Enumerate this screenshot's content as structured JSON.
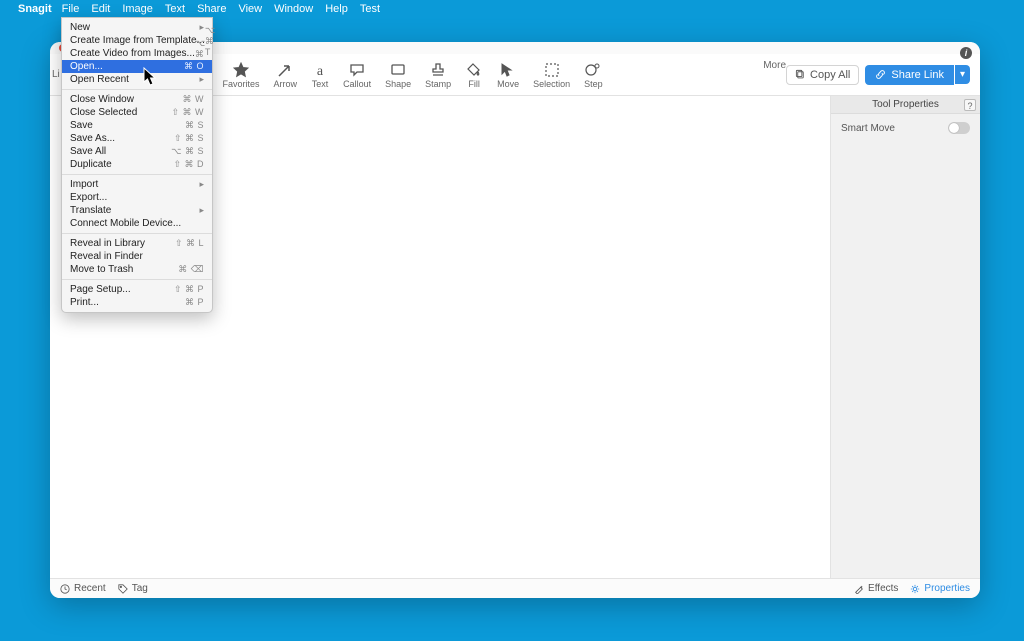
{
  "menubar": {
    "app": "Snagit",
    "items": [
      "File",
      "Edit",
      "Image",
      "Text",
      "Share",
      "View",
      "Window",
      "Help",
      "Test"
    ]
  },
  "file_menu": {
    "groups": [
      [
        {
          "label": "New",
          "shortcut": "",
          "arrow": true,
          "highlight": false
        },
        {
          "label": "Create Image from Template...",
          "shortcut": "⌥ ⌘ T",
          "arrow": false,
          "highlight": false
        },
        {
          "label": "Create Video from Images...",
          "shortcut": "⌥ ⌘ V",
          "arrow": false,
          "highlight": false
        },
        {
          "label": "Open...",
          "shortcut": "⌘ O",
          "arrow": false,
          "highlight": true
        },
        {
          "label": "Open Recent",
          "shortcut": "",
          "arrow": true,
          "highlight": false
        }
      ],
      [
        {
          "label": "Close Window",
          "shortcut": "⌘ W",
          "arrow": false,
          "highlight": false
        },
        {
          "label": "Close Selected",
          "shortcut": "⇧ ⌘ W",
          "arrow": false,
          "highlight": false
        },
        {
          "label": "Save",
          "shortcut": "⌘ S",
          "arrow": false,
          "highlight": false
        },
        {
          "label": "Save As...",
          "shortcut": "⇧ ⌘ S",
          "arrow": false,
          "highlight": false
        },
        {
          "label": "Save All",
          "shortcut": "⌥ ⌘ S",
          "arrow": false,
          "highlight": false
        },
        {
          "label": "Duplicate",
          "shortcut": "⇧ ⌘ D",
          "arrow": false,
          "highlight": false
        }
      ],
      [
        {
          "label": "Import",
          "shortcut": "",
          "arrow": true,
          "highlight": false
        },
        {
          "label": "Export...",
          "shortcut": "",
          "arrow": false,
          "highlight": false
        },
        {
          "label": "Translate",
          "shortcut": "",
          "arrow": true,
          "highlight": false
        },
        {
          "label": "Connect Mobile Device...",
          "shortcut": "",
          "arrow": false,
          "highlight": false
        }
      ],
      [
        {
          "label": "Reveal in Library",
          "shortcut": "⇧ ⌘ L",
          "arrow": false,
          "highlight": false
        },
        {
          "label": "Reveal in Finder",
          "shortcut": "",
          "arrow": false,
          "highlight": false
        },
        {
          "label": "Move to Trash",
          "shortcut": "⌘ ⌫",
          "arrow": false,
          "highlight": false
        }
      ],
      [
        {
          "label": "Page Setup...",
          "shortcut": "⇧ ⌘ P",
          "arrow": false,
          "highlight": false
        },
        {
          "label": "Print...",
          "shortcut": "⌘ P",
          "arrow": false,
          "highlight": false
        }
      ]
    ]
  },
  "tools": [
    {
      "id": "favorites",
      "label": "Favorites"
    },
    {
      "id": "arrow",
      "label": "Arrow"
    },
    {
      "id": "text",
      "label": "Text"
    },
    {
      "id": "callout",
      "label": "Callout"
    },
    {
      "id": "shape",
      "label": "Shape"
    },
    {
      "id": "stamp",
      "label": "Stamp"
    },
    {
      "id": "fill",
      "label": "Fill"
    },
    {
      "id": "move",
      "label": "Move"
    },
    {
      "id": "selection",
      "label": "Selection"
    },
    {
      "id": "step",
      "label": "Step"
    }
  ],
  "toolbar_labels": {
    "more": "More",
    "copy": "Copy All",
    "share": "Share Link"
  },
  "sidebar": {
    "library_initial": "Li"
  },
  "properties": {
    "title": "Tool Properties",
    "smart_move": "Smart Move"
  },
  "bottombar": {
    "recent": "Recent",
    "tag": "Tag",
    "effects": "Effects",
    "properties": "Properties"
  }
}
